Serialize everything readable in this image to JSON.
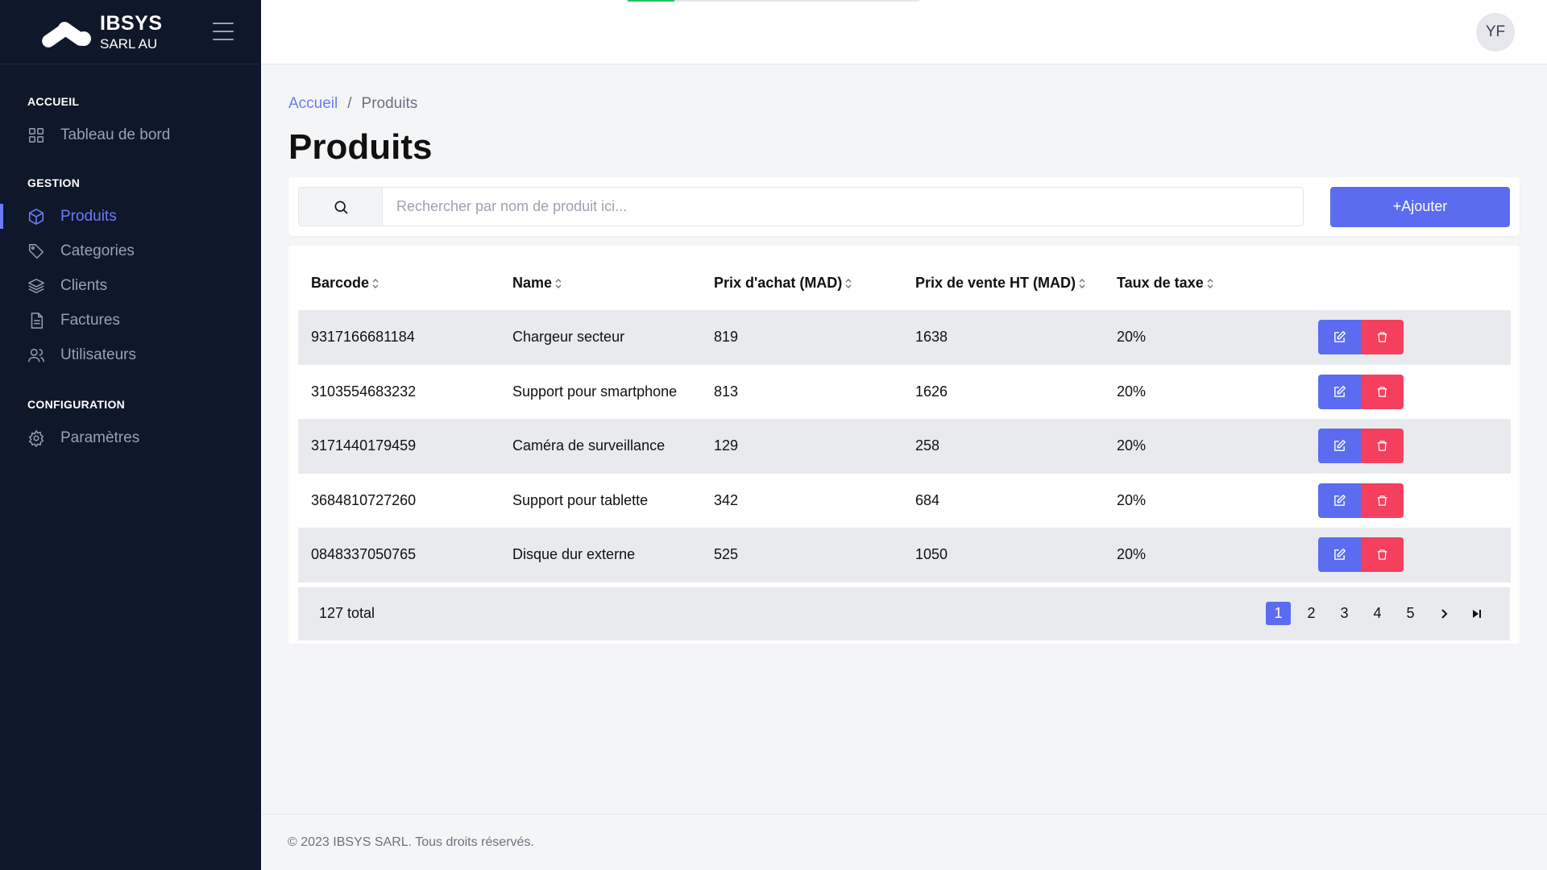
{
  "brand": {
    "name": "IBSYS",
    "subtitle": "SARL AU"
  },
  "sidebar": {
    "sections": [
      {
        "heading": "ACCUEIL",
        "items": [
          {
            "label": "Tableau de bord",
            "icon": "grid-icon"
          }
        ]
      },
      {
        "heading": "GESTION",
        "items": [
          {
            "label": "Produits",
            "icon": "cube-icon",
            "active": true
          },
          {
            "label": "Categories",
            "icon": "tag-icon"
          },
          {
            "label": "Clients",
            "icon": "layers-icon"
          },
          {
            "label": "Factures",
            "icon": "document-icon"
          },
          {
            "label": "Utilisateurs",
            "icon": "users-icon"
          }
        ]
      },
      {
        "heading": "CONFIGURATION",
        "items": [
          {
            "label": "Paramètres",
            "icon": "gear-icon"
          }
        ]
      }
    ]
  },
  "topbar": {
    "avatar_initials": "YF",
    "progress_fraction": 0.16
  },
  "breadcrumb": {
    "home": "Accueil",
    "separator": "/",
    "current": "Produits"
  },
  "page": {
    "title": "Produits"
  },
  "search": {
    "placeholder": "Rechercher par nom de produit ici...",
    "value": ""
  },
  "actions": {
    "add_label": "Ajouter",
    "add_prefix": "+"
  },
  "table": {
    "columns": [
      "Barcode",
      "Name",
      "Prix d'achat (MAD)",
      "Prix de vente HT (MAD)",
      "Taux de taxe"
    ],
    "rows": [
      [
        "9317166681184",
        "Chargeur secteur",
        "819",
        "1638",
        "20%"
      ],
      [
        "3103554683232",
        "Support pour smartphone",
        "813",
        "1626",
        "20%"
      ],
      [
        "3171440179459",
        "Caméra de surveillance",
        "129",
        "258",
        "20%"
      ],
      [
        "3684810727260",
        "Support pour tablette",
        "342",
        "684",
        "20%"
      ],
      [
        "0848337050765",
        "Disque dur externe",
        "525",
        "1050",
        "20%"
      ]
    ]
  },
  "pagination": {
    "total_label": "127 total",
    "pages": [
      "1",
      "2",
      "3",
      "4",
      "5"
    ],
    "current": "1"
  },
  "footer": {
    "text": "© 2023 IBSYS SARL. Tous droits réservés."
  },
  "colors": {
    "sidebar_bg": "#0f172a",
    "accent": "#5b6cf0",
    "danger": "#f43f5e",
    "progress": "#22c55e"
  }
}
